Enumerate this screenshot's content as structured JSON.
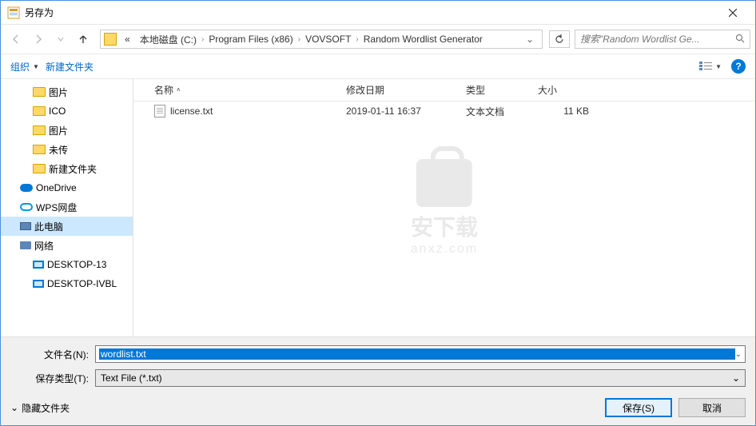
{
  "title": "另存为",
  "breadcrumb": {
    "prefix": "«",
    "items": [
      "本地磁盘 (C:)",
      "Program Files (x86)",
      "VOVSOFT",
      "Random Wordlist Generator"
    ]
  },
  "search": {
    "placeholder": "搜索\"Random Wordlist Ge..."
  },
  "toolbar": {
    "organize": "组织",
    "newFolder": "新建文件夹"
  },
  "sidebar": [
    {
      "label": "图片",
      "icon": "folder",
      "level": 2
    },
    {
      "label": "ICO",
      "icon": "folder",
      "level": 2
    },
    {
      "label": "图片",
      "icon": "folder",
      "level": 2
    },
    {
      "label": "未传",
      "icon": "folder",
      "level": 2
    },
    {
      "label": "新建文件夹",
      "icon": "folder",
      "level": 2
    },
    {
      "label": "OneDrive",
      "icon": "onedrive",
      "level": 1
    },
    {
      "label": "WPS网盘",
      "icon": "wps",
      "level": 1
    },
    {
      "label": "此电脑",
      "icon": "pc",
      "level": 1,
      "selected": true
    },
    {
      "label": "网络",
      "icon": "net",
      "level": 1
    },
    {
      "label": "DESKTOP-13",
      "icon": "mon",
      "level": 2
    },
    {
      "label": "DESKTOP-IVBL",
      "icon": "mon",
      "level": 2
    }
  ],
  "columns": {
    "name": "名称",
    "date": "修改日期",
    "type": "类型",
    "size": "大小"
  },
  "files": [
    {
      "name": "license.txt",
      "date": "2019-01-11 16:37",
      "type": "文本文档",
      "size": "11 KB"
    }
  ],
  "watermark": {
    "text": "安下载",
    "sub": "anxz.com"
  },
  "form": {
    "filenameLabel": "文件名(N):",
    "filenameValue": "wordlist.txt",
    "typeLabel": "保存类型(T):",
    "typeValue": "Text File (*.txt)"
  },
  "actions": {
    "hideFolders": "隐藏文件夹",
    "save": "保存(S)",
    "cancel": "取消"
  }
}
